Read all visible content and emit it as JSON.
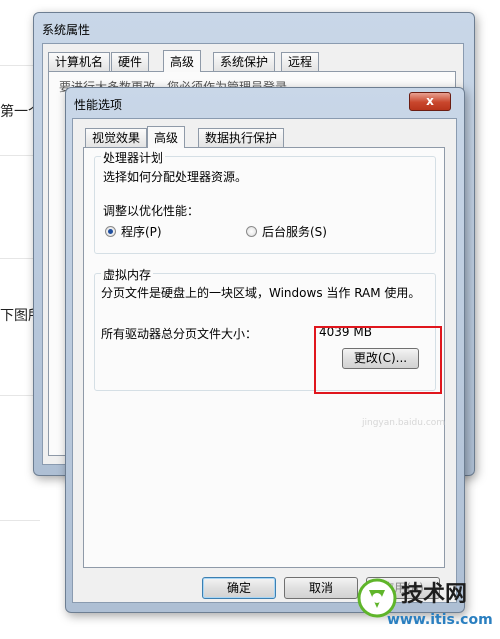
{
  "background": {
    "line1": "第一个",
    "line2": "下图所"
  },
  "system_properties": {
    "title": "系统属性",
    "tabs": [
      "计算机名",
      "硬件",
      "高级",
      "系统保护",
      "远程"
    ],
    "active_tab": "高级",
    "hidden_notice": "要进行大多数更改，您必须作为管理员登录。"
  },
  "perf_options": {
    "title": "性能选项",
    "close_label": "x",
    "tabs": [
      "视觉效果",
      "高级",
      "数据执行保护"
    ],
    "active_tab": "高级",
    "processor_group": {
      "title": "处理器计划",
      "description": "选择如何分配处理器资源。",
      "adjust_label": "调整以优化性能：",
      "options": [
        {
          "label": "程序(P)",
          "checked": true
        },
        {
          "label": "后台服务(S)",
          "checked": false
        }
      ]
    },
    "virtual_memory": {
      "title": "虚拟内存",
      "description": "分页文件是硬盘上的一块区域，Windows 当作 RAM 使用。",
      "total_label": "所有驱动器总分页文件大小：",
      "total_value": "4039 MB",
      "change_button": "更改(C)..."
    },
    "buttons": {
      "ok": "确定",
      "cancel": "取消",
      "apply": "应用(A)"
    }
  },
  "watermark": {
    "brand": "技术网",
    "url": "www.itis.com",
    "faint_text": "jingyan.baidu.com"
  },
  "colors": {
    "highlight": "#e0161d",
    "window_frame": "#b7c8dc",
    "brand_green": "#5fb52a"
  }
}
